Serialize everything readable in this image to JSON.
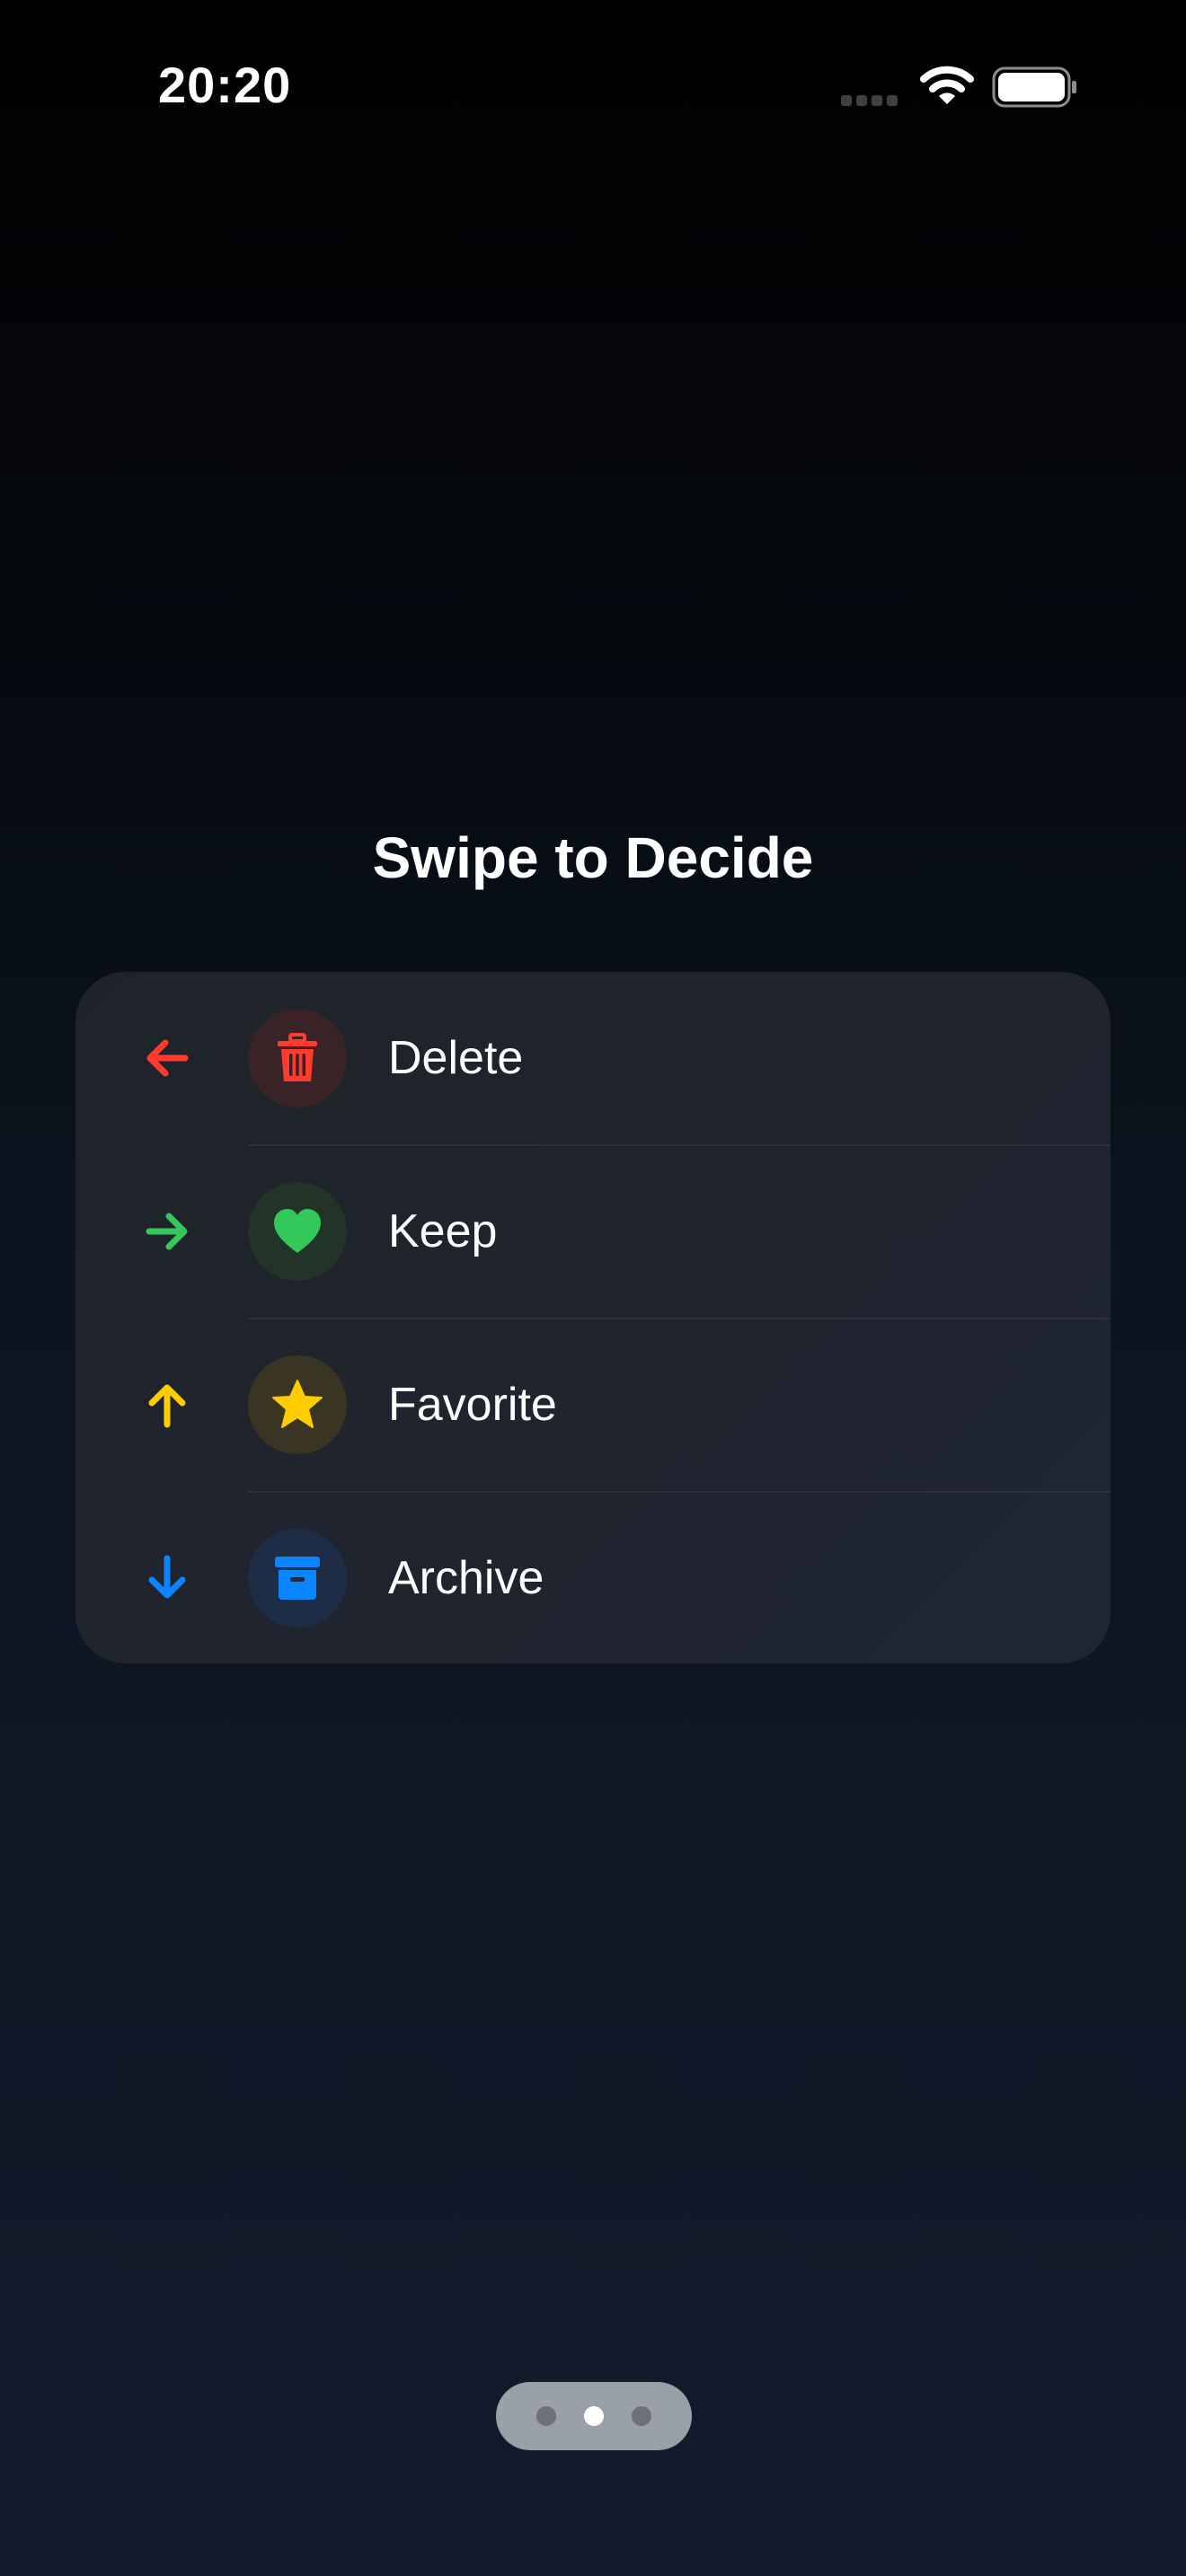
{
  "status_bar": {
    "time": "20:20"
  },
  "title": "Swipe to Decide",
  "actions": [
    {
      "direction": "left",
      "arrow_icon": "arrow-left-icon",
      "badge_icon": "trash-icon",
      "label": "Delete",
      "color": "#ff3b30",
      "badge_bg": "#3a2326"
    },
    {
      "direction": "right",
      "arrow_icon": "arrow-right-icon",
      "badge_icon": "heart-icon",
      "label": "Keep",
      "color": "#34c759",
      "badge_bg": "#223327"
    },
    {
      "direction": "up",
      "arrow_icon": "arrow-up-icon",
      "badge_icon": "star-icon",
      "label": "Favorite",
      "color": "#ffcc00",
      "badge_bg": "#3a3422"
    },
    {
      "direction": "down",
      "arrow_icon": "arrow-down-icon",
      "badge_icon": "archive-icon",
      "label": "Archive",
      "color": "#0a84ff",
      "badge_bg": "#1d2d45"
    }
  ],
  "page_indicator": {
    "count": 3,
    "active_index": 1
  }
}
